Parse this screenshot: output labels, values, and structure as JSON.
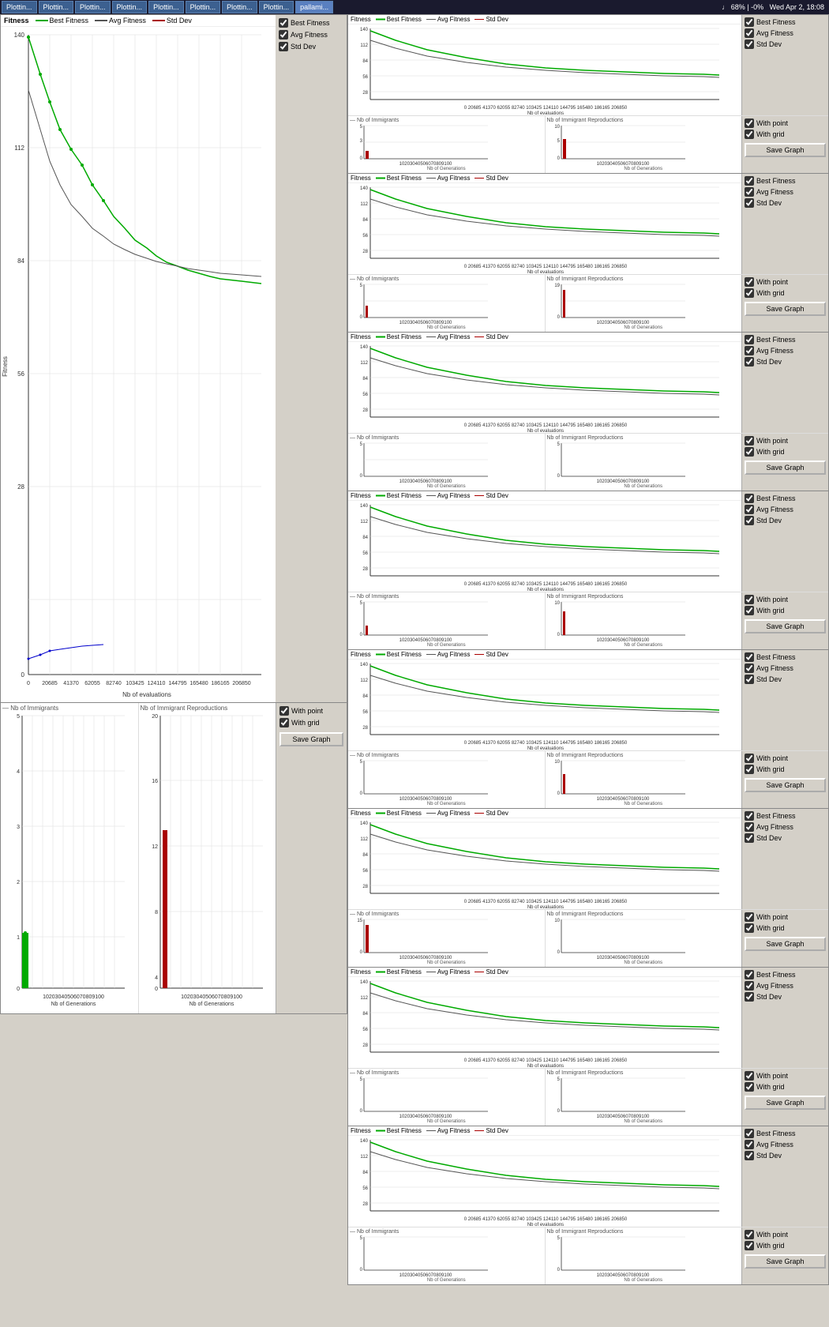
{
  "taskbar": {
    "items": [
      {
        "label": "Plottin...",
        "active": false
      },
      {
        "label": "Plottin...",
        "active": false
      },
      {
        "label": "Plottin...",
        "active": false
      },
      {
        "label": "Plottin...",
        "active": false
      },
      {
        "label": "Plottin...",
        "active": false
      },
      {
        "label": "Plottin...",
        "active": false
      },
      {
        "label": "Plottin...",
        "active": false
      },
      {
        "label": "Plottin...",
        "active": false
      },
      {
        "label": "pallami...",
        "active": false
      }
    ],
    "status": "♩ 68% | -0%",
    "time": "Wed Apr 2, 18:08"
  },
  "left_main_chart": {
    "title": "Fitness",
    "y_max": 140,
    "x_label": "Nb of evaluations",
    "x_ticks": [
      "0",
      "20685",
      "41370",
      "62055",
      "82740",
      "103425",
      "124110",
      "144795",
      "165480",
      "186165",
      "206850"
    ],
    "y_ticks": [
      "0",
      "28",
      "56",
      "84",
      "112",
      "140"
    ],
    "legend": [
      {
        "label": "Best Fitness",
        "color": "#00aa00"
      },
      {
        "label": "Avg Fitness",
        "color": "#555555"
      },
      {
        "label": "Std Dev",
        "color": "#aa0000"
      }
    ],
    "checkboxes": [
      {
        "label": "Best Fitness",
        "checked": true
      },
      {
        "label": "Avg Fitness",
        "checked": true
      },
      {
        "label": "Std Dev",
        "checked": true
      }
    ]
  },
  "left_bottom": {
    "immigrants_title": "Nb of Immigrants",
    "reproductions_title": "Nb of Immigrant Reproductions",
    "x_label": "Nb of Generations",
    "x_ticks": "10203040506070809100",
    "y_ticks_imm": [
      "0",
      "1",
      "2",
      "3",
      "4",
      "5"
    ],
    "y_ticks_rep": [
      "0",
      "4",
      "8",
      "12",
      "16",
      "20"
    ],
    "checkboxes": [
      {
        "label": "With point",
        "checked": true
      },
      {
        "label": "With grid",
        "checked": true
      }
    ],
    "save_label": "Save Graph"
  },
  "right_rows": [
    {
      "fitness": {
        "title": "Fitness",
        "legend": [
          "Best Fitness",
          "Avg Fitness",
          "Std Dev"
        ],
        "checks": [
          true,
          true,
          true
        ]
      },
      "immigrants_title": "Nb of Immigrants",
      "reproductions_title": "Nb of Immigrant Reproductions",
      "controls": {
        "with_point": true,
        "with_grid": true,
        "save": "Save Graph"
      }
    },
    {
      "fitness": {
        "title": "Fitness",
        "legend": [
          "Best Fitness",
          "Avg Fitness",
          "Std Dev"
        ],
        "checks": [
          true,
          true,
          true
        ]
      },
      "immigrants_title": "Nb of Immigrants",
      "reproductions_title": "Nb of Immigrant Reproductions",
      "controls": {
        "with_point": true,
        "with_grid": true,
        "save": "Save Graph"
      }
    },
    {
      "fitness": {
        "title": "Fitness",
        "legend": [
          "Best Fitness",
          "Avg Fitness",
          "Std Dev"
        ],
        "checks": [
          true,
          true,
          true
        ]
      },
      "immigrants_title": "Nb of Immigrants",
      "reproductions_title": "Nb of Immigrant Reproductions",
      "controls": {
        "with_point": true,
        "with_grid": true,
        "save": "Save Graph"
      }
    },
    {
      "fitness": {
        "title": "Fitness",
        "legend": [
          "Best Fitness",
          "Avg Fitness",
          "Std Dev"
        ],
        "checks": [
          true,
          true,
          true
        ]
      },
      "immigrants_title": "Nb of Immigrants",
      "reproductions_title": "Nb of Immigrant Reproductions",
      "controls": {
        "with_point": true,
        "with_grid": true,
        "save": "Save Graph"
      }
    },
    {
      "fitness": {
        "title": "Fitness",
        "legend": [
          "Best Fitness",
          "Avg Fitness",
          "Std Dev"
        ],
        "checks": [
          true,
          true,
          true
        ]
      },
      "immigrants_title": "Nb of Immigrants",
      "reproductions_title": "Nb of Immigrant Reproductions",
      "controls": {
        "with_point": true,
        "with_grid": true,
        "save": "Save Graph"
      }
    },
    {
      "fitness": {
        "title": "Fitness",
        "legend": [
          "Best Fitness",
          "Avg Fitness",
          "Std Dev"
        ],
        "checks": [
          true,
          true,
          true
        ]
      },
      "immigrants_title": "Nb of Immigrants",
      "reproductions_title": "Nb of Immigrant Reproductions",
      "controls": {
        "with_point": true,
        "with_grid": true,
        "save": "Save Graph"
      }
    },
    {
      "fitness": {
        "title": "Fitness",
        "legend": [
          "Best Fitness",
          "Avg Fitness",
          "Std Dev"
        ],
        "checks": [
          true,
          true,
          true
        ]
      },
      "immigrants_title": "Nb of Immigrants",
      "reproductions_title": "Nb of Immigrant Reproductions",
      "controls": {
        "with_point": true,
        "with_grid": true,
        "save": "Save Graph"
      }
    },
    {
      "fitness": {
        "title": "Fitness",
        "legend": [
          "Best Fitness",
          "Avg Fitness",
          "Std Dev"
        ],
        "checks": [
          true,
          true,
          true
        ]
      },
      "immigrants_title": "Nb of Immigrants",
      "reproductions_title": "Nb of Immigrant Reproductions",
      "controls": {
        "with_point": true,
        "with_grid": true,
        "save": "Save Graph"
      }
    }
  ],
  "colors": {
    "best_fitness": "#00aa00",
    "avg_fitness": "#555555",
    "std_dev": "#aa0000",
    "immigrants": "#aa0000",
    "reproductions": "#aa0000",
    "background": "#ffffff",
    "grid": "#dddddd",
    "axis": "#333333"
  }
}
